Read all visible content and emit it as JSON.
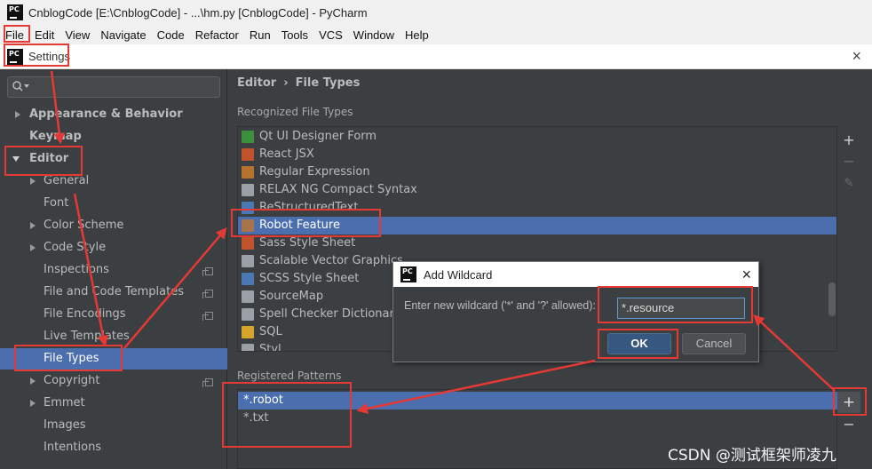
{
  "window": {
    "title": "CnblogCode [E:\\CnblogCode] - ...\\hm.py [CnblogCode] - PyCharm",
    "logo_text": "PC"
  },
  "menu": [
    "File",
    "Edit",
    "View",
    "Navigate",
    "Code",
    "Refactor",
    "Run",
    "Tools",
    "VCS",
    "Window",
    "Help"
  ],
  "settings": {
    "title": "Settings",
    "close": "×"
  },
  "sidebar": {
    "items": [
      {
        "label": "Appearance & Behavior"
      },
      {
        "label": "Keymap"
      },
      {
        "label": "Editor"
      },
      {
        "label": "General"
      },
      {
        "label": "Font"
      },
      {
        "label": "Color Scheme"
      },
      {
        "label": "Code Style"
      },
      {
        "label": "Inspections"
      },
      {
        "label": "File and Code Templates"
      },
      {
        "label": "File Encodings"
      },
      {
        "label": "Live Templates"
      },
      {
        "label": "File Types"
      },
      {
        "label": "Copyright"
      },
      {
        "label": "Emmet"
      },
      {
        "label": "Images"
      },
      {
        "label": "Intentions"
      }
    ]
  },
  "breadcrumb": {
    "parent": "Editor",
    "sep": "›",
    "current": "File Types"
  },
  "recognized": {
    "label": "Recognized File Types",
    "items": [
      {
        "label": "Qt UI Designer Form",
        "color": "#3c8f3c"
      },
      {
        "label": "React JSX",
        "color": "#c0532b"
      },
      {
        "label": "Regular Expression",
        "color": "#b5732e"
      },
      {
        "label": "RELAX NG Compact Syntax",
        "color": "#9aa0a6"
      },
      {
        "label": "ReStructuredText",
        "color": "#4a78b5"
      },
      {
        "label": "Robot Feature",
        "color": "#a8744a"
      },
      {
        "label": "Sass Style Sheet",
        "color": "#c0532b"
      },
      {
        "label": "Scalable Vector Graphics",
        "color": "#9aa0a6"
      },
      {
        "label": "SCSS Style Sheet",
        "color": "#4a78b5"
      },
      {
        "label": "SourceMap",
        "color": "#9aa0a6"
      },
      {
        "label": "Spell Checker Dictionary",
        "color": "#9aa0a6"
      },
      {
        "label": "SQL",
        "color": "#d6a32b"
      },
      {
        "label": "Styl",
        "color": "#9aa0a6"
      }
    ]
  },
  "registered": {
    "label": "Registered Patterns",
    "items": [
      "*.robot",
      "*.txt"
    ]
  },
  "side_buttons": {
    "add": "+",
    "remove": "−",
    "edit": "✎"
  },
  "dialog": {
    "title": "Add Wildcard",
    "prompt": "Enter new wildcard ('*' and '?' allowed):",
    "value": "*.resource",
    "ok": "OK",
    "cancel": "Cancel",
    "close": "×"
  },
  "watermark": "CSDN @测试框架师凌九",
  "colors": {
    "selection": "#4b6eaf",
    "annotation": "#e53935",
    "background": "#3c3f41"
  }
}
